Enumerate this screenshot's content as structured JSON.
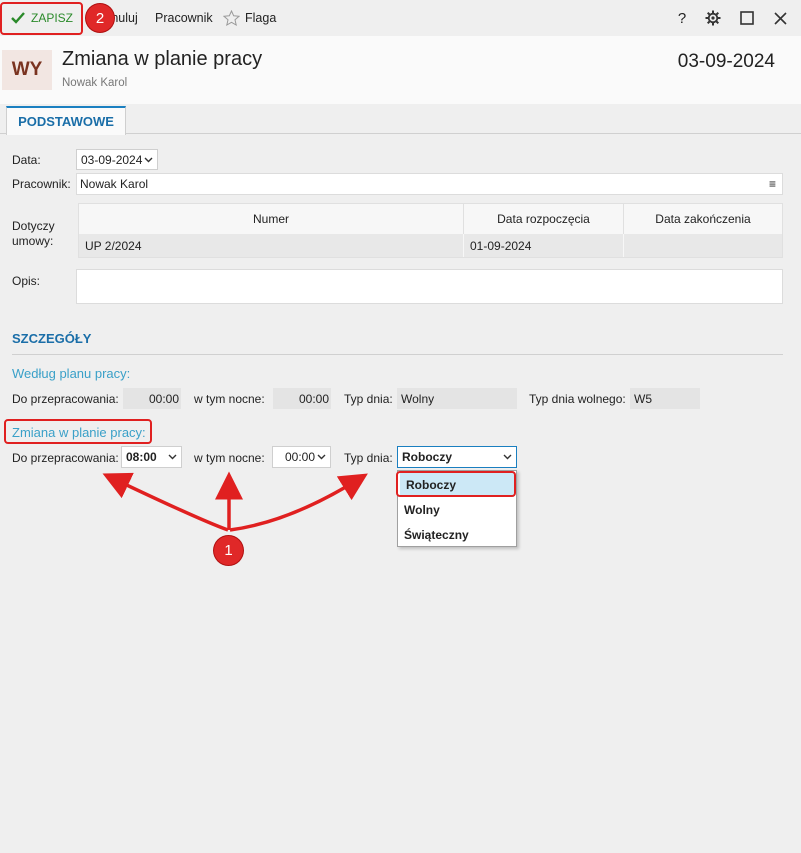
{
  "toolbar": {
    "save_label": "ZAPISZ",
    "cancel_label": "Anuluj",
    "employee_label": "Pracownik",
    "flag_label": "Flaga",
    "help_label": "?"
  },
  "header": {
    "avatar_text": "WY",
    "title": "Zmiana w planie pracy",
    "subtitle": "Nowak Karol",
    "date": "03-09-2024"
  },
  "tabs": [
    {
      "label": "PODSTAWOWE"
    }
  ],
  "form": {
    "date_label": "Data:",
    "date_value": "03-09-2024",
    "employee_label": "Pracownik:",
    "employee_value": "Nowak Karol",
    "contract_label": "Dotyczy umowy:",
    "contract_columns": [
      "Numer",
      "Data rozpoczęcia",
      "Data zakończenia"
    ],
    "contract_rows": [
      [
        "UP 2/2024",
        "01-09-2024",
        ""
      ]
    ],
    "desc_label": "Opis:",
    "desc_value": ""
  },
  "details": {
    "title": "SZCZEGÓŁY",
    "plan_title": "Według planu pracy:",
    "plan": {
      "to_work_label": "Do przepracowania:",
      "to_work_value": "00:00",
      "night_label": "w tym nocne:",
      "night_value": "00:00",
      "day_type_label": "Typ dnia:",
      "day_type_value": "Wolny",
      "free_day_type_label": "Typ dnia wolnego:",
      "free_day_type_value": "W5"
    },
    "change_title": "Zmiana w planie pracy:",
    "change": {
      "to_work_label": "Do przepracowania:",
      "to_work_value": "08:00",
      "night_label": "w tym nocne:",
      "night_value": "00:00",
      "day_type_label": "Typ dnia:",
      "day_type_value": "Roboczy",
      "day_type_options": [
        "Roboczy",
        "Wolny",
        "Świąteczny"
      ]
    }
  },
  "annotations": {
    "marker_1": "1",
    "marker_2": "2"
  },
  "colors": {
    "accent": "#1a6ea8",
    "annotation": "#e02020",
    "save_green": "#2a8a2a"
  }
}
